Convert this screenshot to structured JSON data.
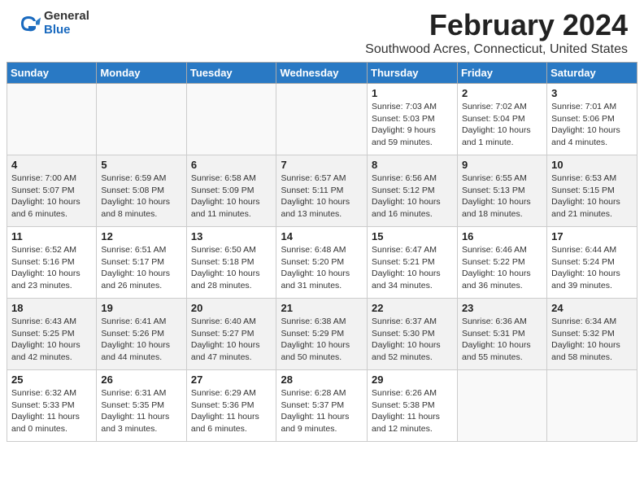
{
  "header": {
    "title": "February 2024",
    "subtitle": "Southwood Acres, Connecticut, United States",
    "logo_general": "General",
    "logo_blue": "Blue"
  },
  "days_of_week": [
    "Sunday",
    "Monday",
    "Tuesday",
    "Wednesday",
    "Thursday",
    "Friday",
    "Saturday"
  ],
  "weeks": [
    [
      {
        "num": "",
        "info": "",
        "empty": true
      },
      {
        "num": "",
        "info": "",
        "empty": true
      },
      {
        "num": "",
        "info": "",
        "empty": true
      },
      {
        "num": "",
        "info": "",
        "empty": true
      },
      {
        "num": "1",
        "info": "Sunrise: 7:03 AM\nSunset: 5:03 PM\nDaylight: 9 hours\nand 59 minutes."
      },
      {
        "num": "2",
        "info": "Sunrise: 7:02 AM\nSunset: 5:04 PM\nDaylight: 10 hours\nand 1 minute."
      },
      {
        "num": "3",
        "info": "Sunrise: 7:01 AM\nSunset: 5:06 PM\nDaylight: 10 hours\nand 4 minutes."
      }
    ],
    [
      {
        "num": "4",
        "info": "Sunrise: 7:00 AM\nSunset: 5:07 PM\nDaylight: 10 hours\nand 6 minutes."
      },
      {
        "num": "5",
        "info": "Sunrise: 6:59 AM\nSunset: 5:08 PM\nDaylight: 10 hours\nand 8 minutes."
      },
      {
        "num": "6",
        "info": "Sunrise: 6:58 AM\nSunset: 5:09 PM\nDaylight: 10 hours\nand 11 minutes."
      },
      {
        "num": "7",
        "info": "Sunrise: 6:57 AM\nSunset: 5:11 PM\nDaylight: 10 hours\nand 13 minutes."
      },
      {
        "num": "8",
        "info": "Sunrise: 6:56 AM\nSunset: 5:12 PM\nDaylight: 10 hours\nand 16 minutes."
      },
      {
        "num": "9",
        "info": "Sunrise: 6:55 AM\nSunset: 5:13 PM\nDaylight: 10 hours\nand 18 minutes."
      },
      {
        "num": "10",
        "info": "Sunrise: 6:53 AM\nSunset: 5:15 PM\nDaylight: 10 hours\nand 21 minutes."
      }
    ],
    [
      {
        "num": "11",
        "info": "Sunrise: 6:52 AM\nSunset: 5:16 PM\nDaylight: 10 hours\nand 23 minutes."
      },
      {
        "num": "12",
        "info": "Sunrise: 6:51 AM\nSunset: 5:17 PM\nDaylight: 10 hours\nand 26 minutes."
      },
      {
        "num": "13",
        "info": "Sunrise: 6:50 AM\nSunset: 5:18 PM\nDaylight: 10 hours\nand 28 minutes."
      },
      {
        "num": "14",
        "info": "Sunrise: 6:48 AM\nSunset: 5:20 PM\nDaylight: 10 hours\nand 31 minutes."
      },
      {
        "num": "15",
        "info": "Sunrise: 6:47 AM\nSunset: 5:21 PM\nDaylight: 10 hours\nand 34 minutes."
      },
      {
        "num": "16",
        "info": "Sunrise: 6:46 AM\nSunset: 5:22 PM\nDaylight: 10 hours\nand 36 minutes."
      },
      {
        "num": "17",
        "info": "Sunrise: 6:44 AM\nSunset: 5:24 PM\nDaylight: 10 hours\nand 39 minutes."
      }
    ],
    [
      {
        "num": "18",
        "info": "Sunrise: 6:43 AM\nSunset: 5:25 PM\nDaylight: 10 hours\nand 42 minutes."
      },
      {
        "num": "19",
        "info": "Sunrise: 6:41 AM\nSunset: 5:26 PM\nDaylight: 10 hours\nand 44 minutes."
      },
      {
        "num": "20",
        "info": "Sunrise: 6:40 AM\nSunset: 5:27 PM\nDaylight: 10 hours\nand 47 minutes."
      },
      {
        "num": "21",
        "info": "Sunrise: 6:38 AM\nSunset: 5:29 PM\nDaylight: 10 hours\nand 50 minutes."
      },
      {
        "num": "22",
        "info": "Sunrise: 6:37 AM\nSunset: 5:30 PM\nDaylight: 10 hours\nand 52 minutes."
      },
      {
        "num": "23",
        "info": "Sunrise: 6:36 AM\nSunset: 5:31 PM\nDaylight: 10 hours\nand 55 minutes."
      },
      {
        "num": "24",
        "info": "Sunrise: 6:34 AM\nSunset: 5:32 PM\nDaylight: 10 hours\nand 58 minutes."
      }
    ],
    [
      {
        "num": "25",
        "info": "Sunrise: 6:32 AM\nSunset: 5:33 PM\nDaylight: 11 hours\nand 0 minutes."
      },
      {
        "num": "26",
        "info": "Sunrise: 6:31 AM\nSunset: 5:35 PM\nDaylight: 11 hours\nand 3 minutes."
      },
      {
        "num": "27",
        "info": "Sunrise: 6:29 AM\nSunset: 5:36 PM\nDaylight: 11 hours\nand 6 minutes."
      },
      {
        "num": "28",
        "info": "Sunrise: 6:28 AM\nSunset: 5:37 PM\nDaylight: 11 hours\nand 9 minutes."
      },
      {
        "num": "29",
        "info": "Sunrise: 6:26 AM\nSunset: 5:38 PM\nDaylight: 11 hours\nand 12 minutes."
      },
      {
        "num": "",
        "info": "",
        "empty": true
      },
      {
        "num": "",
        "info": "",
        "empty": true
      }
    ]
  ]
}
